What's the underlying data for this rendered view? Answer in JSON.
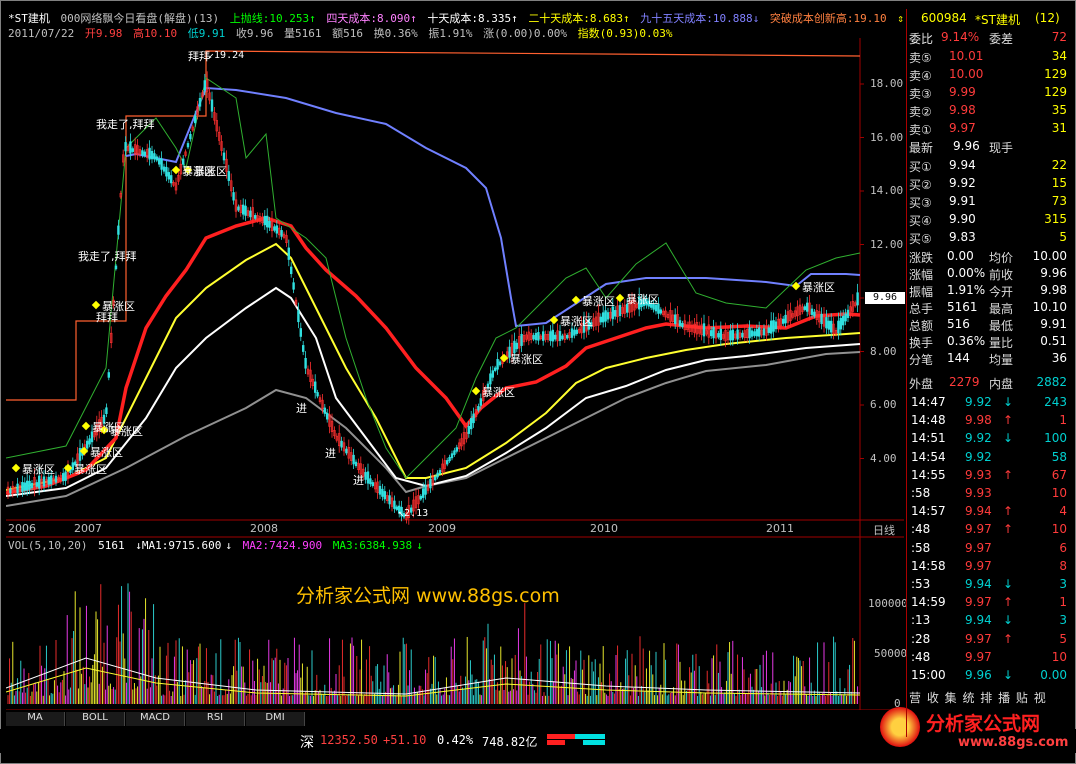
{
  "header": {
    "line1": [
      "*ST建机",
      "000网络飘今日看盘(解盘)(13)",
      "上抛线:10.253↑",
      "四天成本:8.090↑",
      "十天成本:8.335↑",
      "二十天成本:8.683↑",
      "九十五天成本:10.888↓",
      "突破成本创新高:19.10",
      "⇕"
    ],
    "line2": [
      "2011/07/22",
      "开9.98",
      "高10.10",
      "低9.91",
      "收9.96",
      "量5161",
      "额516",
      "换0.36%",
      "振1.91%",
      "涨(0.00)0.00%",
      "指数(0.93)0.03%"
    ]
  },
  "price_axis": {
    "labels": [
      "18.00",
      "16.00",
      "14.00",
      "12.00",
      "10.00",
      "8.00",
      "6.00",
      "4.00"
    ],
    "current": "9.96"
  },
  "year_axis": {
    "labels": [
      "2006",
      "2007",
      "2008",
      "2009",
      "2010",
      "2011",
      "日线"
    ]
  },
  "annotations": {
    "high": "19.24",
    "low": "2.13",
    "texts": [
      "拜拜",
      "我走了,拜拜",
      "我走了,拜拜",
      "拜拜",
      "进",
      "进",
      "进"
    ],
    "baozhang": "暴涨区"
  },
  "volume": {
    "title": "VOL(5,10,20)",
    "value": "5161",
    "ma1": "MA1:9715.600",
    "ma2": "MA2:7424.900",
    "ma3": "MA3:6384.938",
    "axis": [
      "100000",
      "50000",
      "0"
    ]
  },
  "watermark": "分析家公式网 www.88gs.com",
  "tabs": [
    "MA",
    "BOLL",
    "MACD",
    "RSI",
    "DMI"
  ],
  "status_bar": {
    "market": "深",
    "index": "12352.50",
    "change": "+51.10",
    "pct": "0.42%",
    "amount": "748.82亿"
  },
  "logo": {
    "line1": "分析家公式网",
    "line2": "www.88gs.com"
  },
  "quote": {
    "code": "600984",
    "name": "*ST建机",
    "count": "(12)",
    "weibi_label": "委比",
    "weibi": "9.14%",
    "weicha_label": "委差",
    "weicha": "72",
    "sells": [
      {
        "label": "卖⑤",
        "price": "10.01",
        "vol": "34"
      },
      {
        "label": "卖④",
        "price": "10.00",
        "vol": "129"
      },
      {
        "label": "卖③",
        "price": "9.99",
        "vol": "129"
      },
      {
        "label": "卖②",
        "price": "9.98",
        "vol": "35"
      },
      {
        "label": "卖①",
        "price": "9.97",
        "vol": "31"
      }
    ],
    "latest_label": "最新",
    "latest": "9.96",
    "xianshou_label": "现手",
    "buys": [
      {
        "label": "买①",
        "price": "9.94",
        "vol": "22"
      },
      {
        "label": "买②",
        "price": "9.92",
        "vol": "15"
      },
      {
        "label": "买③",
        "price": "9.91",
        "vol": "73"
      },
      {
        "label": "买④",
        "price": "9.90",
        "vol": "315"
      },
      {
        "label": "买⑤",
        "price": "9.83",
        "vol": "5"
      }
    ],
    "stats": [
      {
        "l1": "涨跌",
        "v1": "0.00",
        "l2": "均价",
        "v2": "10.00"
      },
      {
        "l1": "涨幅",
        "v1": "0.00%",
        "l2": "前收",
        "v2": "9.96"
      },
      {
        "l1": "振幅",
        "v1": "1.91%",
        "l2": "今开",
        "v2": "9.98"
      },
      {
        "l1": "总手",
        "v1": "5161",
        "l2": "最高",
        "v2": "10.10"
      },
      {
        "l1": "总额",
        "v1": "516",
        "l2": "最低",
        "v2": "9.91"
      },
      {
        "l1": "换手",
        "v1": "0.36%",
        "l2": "量比",
        "v2": "0.51"
      },
      {
        "l1": "分笔",
        "v1": "144",
        "l2": "均量",
        "v2": "36"
      }
    ],
    "waipan_label": "外盘",
    "waipan": "2279",
    "neipan_label": "内盘",
    "neipan": "2882",
    "ticks": [
      {
        "t": "14:47",
        "p": "9.92",
        "v": "243",
        "c": "green",
        "a": "↓"
      },
      {
        "t": "14:48",
        "p": "9.98",
        "v": "1",
        "c": "red",
        "a": "↑"
      },
      {
        "t": "14:51",
        "p": "9.92",
        "v": "100",
        "c": "green",
        "a": "↓"
      },
      {
        "t": "14:54",
        "p": "9.92",
        "v": "58",
        "c": "green",
        "a": ""
      },
      {
        "t": "14:55",
        "p": "9.93",
        "v": "67",
        "c": "red",
        "a": "↑"
      },
      {
        "t": ":58",
        "p": "9.93",
        "v": "10",
        "c": "red",
        "a": ""
      },
      {
        "t": "14:57",
        "p": "9.94",
        "v": "4",
        "c": "red",
        "a": "↑"
      },
      {
        "t": ":48",
        "p": "9.97",
        "v": "10",
        "c": "red",
        "a": "↑"
      },
      {
        "t": ":58",
        "p": "9.97",
        "v": "6",
        "c": "red",
        "a": ""
      },
      {
        "t": "14:58",
        "p": "9.97",
        "v": "8",
        "c": "red",
        "a": ""
      },
      {
        "t": ":53",
        "p": "9.94",
        "v": "3",
        "c": "green",
        "a": "↓"
      },
      {
        "t": "14:59",
        "p": "9.97",
        "v": "1",
        "c": "red",
        "a": "↑"
      },
      {
        "t": ":13",
        "p": "9.94",
        "v": "3",
        "c": "green",
        "a": "↓"
      },
      {
        "t": ":28",
        "p": "9.97",
        "v": "5",
        "c": "red",
        "a": "↑"
      },
      {
        "t": ":48",
        "p": "9.97",
        "v": "10",
        "c": "red",
        "a": ""
      },
      {
        "t": "15:00",
        "p": "9.96",
        "v": "0.00",
        "c": "green",
        "a": "↓"
      }
    ],
    "bottom_menu": "营 收 集 统 排 播 贴 视"
  }
}
